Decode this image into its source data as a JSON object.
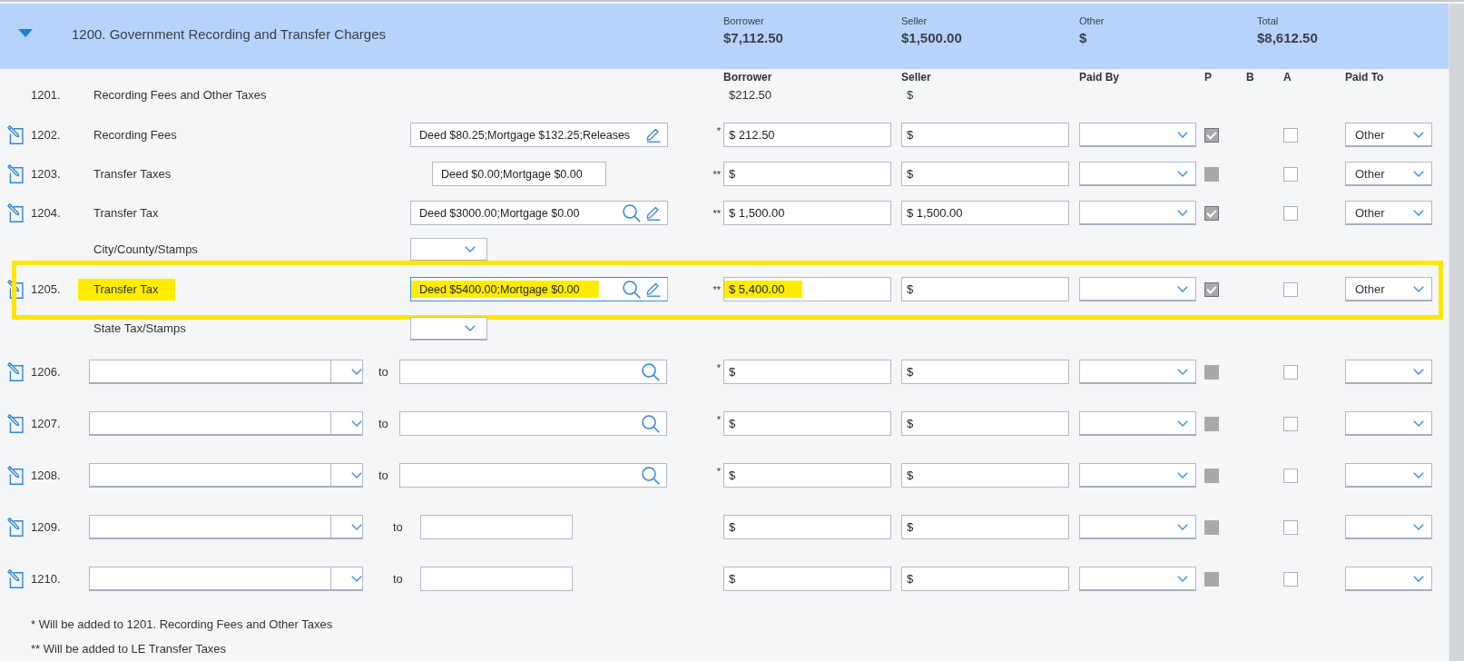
{
  "section": {
    "title": "1200. Government Recording and Transfer Charges",
    "expanded": true,
    "totals": [
      {
        "label": "Borrower",
        "value": "$7,112.50"
      },
      {
        "label": "Seller",
        "value": "$1,500.00"
      },
      {
        "label": "Other",
        "value": "$"
      },
      {
        "label": "Total",
        "value": "$8,612.50"
      }
    ]
  },
  "columns": [
    "Borrower",
    "Seller",
    "Paid By",
    "P",
    "B",
    "A",
    "Paid To"
  ],
  "rows": [
    {
      "kind": "summary",
      "number": "1201.",
      "label": "Recording Fees and Other Taxes",
      "borrower": "$212.50",
      "seller": "$",
      "highlighted": false
    },
    {
      "kind": "fixed",
      "number": "1202.",
      "label": "Recording Fees",
      "description": {
        "kind": "edit",
        "value": "Deed $80.25;Mortgage $132.25;Releases",
        "focused": false
      },
      "note": "*",
      "borrower": "$ 212.50",
      "seller": "$",
      "p_checked": true,
      "a_checked": false,
      "paid_to": "Other",
      "highlighted": false
    },
    {
      "kind": "fixed",
      "number": "1203.",
      "label": "Transfer Taxes",
      "description": {
        "kind": "plain",
        "value": "Deed $0.00;Mortgage $0.00",
        "focused": false
      },
      "note": "**",
      "borrower": "$",
      "seller": "$",
      "p_checked": false,
      "a_checked": false,
      "paid_to": "Other",
      "highlighted": false
    },
    {
      "kind": "fixed",
      "number": "1204.",
      "label": "Transfer Tax",
      "description": {
        "kind": "search_edit",
        "value": "Deed $3000.00;Mortgage $0.00",
        "focused": false
      },
      "note": "**",
      "borrower": "$ 1,500.00",
      "seller": "$ 1,500.00",
      "p_checked": true,
      "a_checked": false,
      "paid_to": "Other",
      "sub_label": "City/County/Stamps",
      "highlighted": false
    },
    {
      "kind": "fixed",
      "number": "1205.",
      "label": "Transfer Tax",
      "description": {
        "kind": "search_edit",
        "value": "Deed $5400.00;Mortgage $0.00",
        "focused": true
      },
      "note": "**",
      "borrower": "$ 5,400.00",
      "seller": "$",
      "p_checked": true,
      "a_checked": false,
      "paid_to": "Other",
      "sub_label": "State Tax/Stamps",
      "highlighted": true
    },
    {
      "kind": "custom",
      "number": "1206.",
      "to_label": "to",
      "payee_field": {
        "kind": "search"
      },
      "note": "*",
      "borrower": "$",
      "seller": "$",
      "p_checked": false,
      "a_checked": false,
      "highlighted": false
    },
    {
      "kind": "custom",
      "number": "1207.",
      "to_label": "to",
      "payee_field": {
        "kind": "search"
      },
      "note": "*",
      "borrower": "$",
      "seller": "$",
      "p_checked": false,
      "a_checked": false,
      "highlighted": false
    },
    {
      "kind": "custom",
      "number": "1208.",
      "to_label": "to",
      "payee_field": {
        "kind": "search"
      },
      "note": "*",
      "borrower": "$",
      "seller": "$",
      "p_checked": false,
      "a_checked": false,
      "highlighted": false
    },
    {
      "kind": "custom",
      "number": "1209.",
      "to_label": "to",
      "payee_field": {
        "kind": "plain"
      },
      "borrower": "$",
      "seller": "$",
      "p_checked": false,
      "a_checked": false,
      "highlighted": false
    },
    {
      "kind": "custom",
      "number": "1210.",
      "to_label": "to",
      "payee_field": {
        "kind": "plain"
      },
      "borrower": "$",
      "seller": "$",
      "p_checked": false,
      "a_checked": false,
      "highlighted": false
    }
  ],
  "footnotes": [
    "* Will be added to 1201. Recording Fees and Other Taxes",
    "** Will be added to LE Transfer Taxes"
  ]
}
